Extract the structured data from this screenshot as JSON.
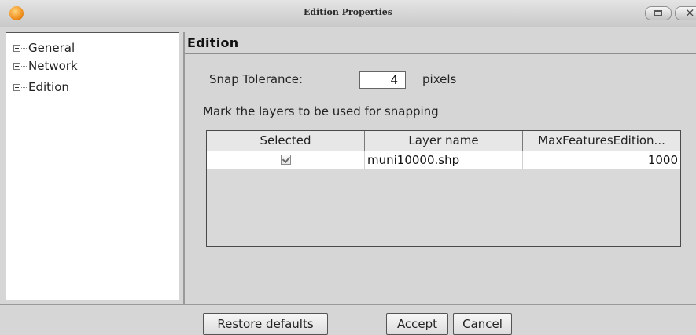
{
  "window": {
    "title": "Edition Properties"
  },
  "tree": {
    "items": [
      {
        "label": "General"
      },
      {
        "label": "Network"
      },
      {
        "label": "Edition"
      }
    ]
  },
  "panel": {
    "title": "Edition",
    "snap_label": "Snap Tolerance:",
    "snap_value": "4",
    "snap_unit": "pixels",
    "mark_label": "Mark the layers to be used for snapping",
    "table": {
      "headers": [
        "Selected",
        "Layer name",
        "MaxFeaturesEdition..."
      ],
      "rows": [
        {
          "selected": true,
          "layer": "muni10000.shp",
          "max": "1000"
        }
      ]
    }
  },
  "buttons": {
    "restore": "Restore defaults",
    "accept": "Accept",
    "cancel": "Cancel"
  },
  "icons": {
    "app": "app-logo-icon",
    "minimize": "minimize-icon",
    "close": "close-icon"
  }
}
